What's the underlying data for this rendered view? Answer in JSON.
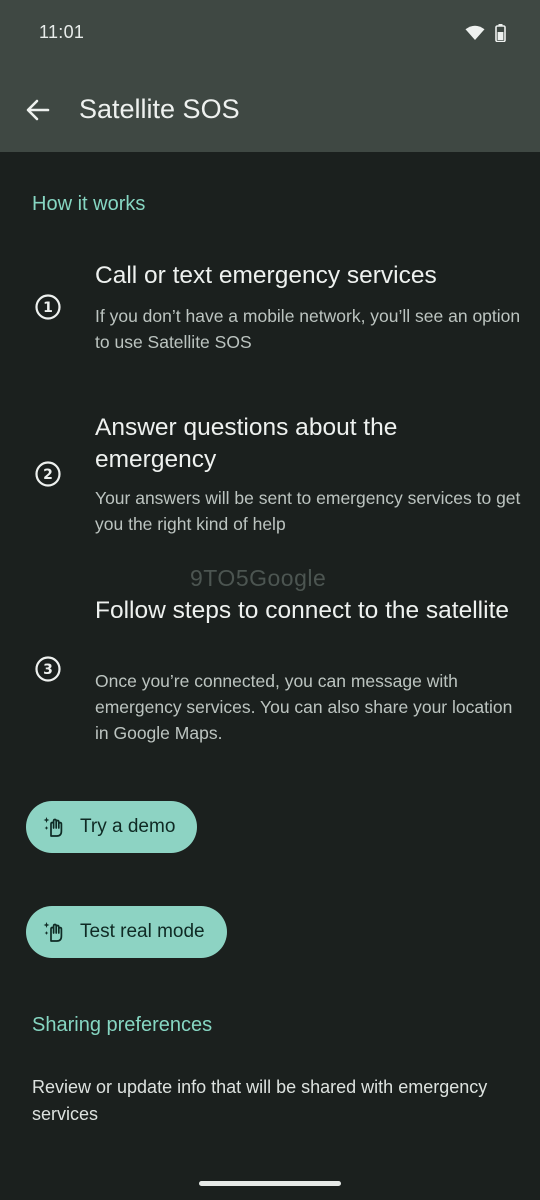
{
  "status_bar": {
    "time": "11:01",
    "icons": [
      "wifi-icon",
      "battery-icon"
    ]
  },
  "app_bar": {
    "title": "Satellite SOS",
    "back_icon": "arrow-back-icon"
  },
  "how_it_works": {
    "heading": "How it works",
    "steps": [
      {
        "number": "1",
        "title": "Call or text emergency services",
        "description": "If you don’t have a mobile network, you’ll see an option to use Satellite SOS"
      },
      {
        "number": "2",
        "title": "Answer questions about the emergency",
        "description": "Your answers will be sent to emergency services to get you the right kind of help"
      },
      {
        "number": "3",
        "title": "Follow steps to connect to the satellite",
        "description": "Once you’re connected, you can message with emergency services. You can also share your location in Google Maps."
      }
    ]
  },
  "watermark": "9TO5Google",
  "buttons": {
    "demo_label": "Try a demo",
    "real_mode_label": "Test real mode",
    "icon": "hand-sparkle-icon"
  },
  "sharing": {
    "heading": "Sharing preferences",
    "description": "Review or update info that will be shared with emergency services"
  },
  "colors": {
    "background": "#1b201e",
    "app_bar": "#3f4843",
    "accent": "#86d6c2",
    "pill_bg": "#8dd3c3"
  }
}
